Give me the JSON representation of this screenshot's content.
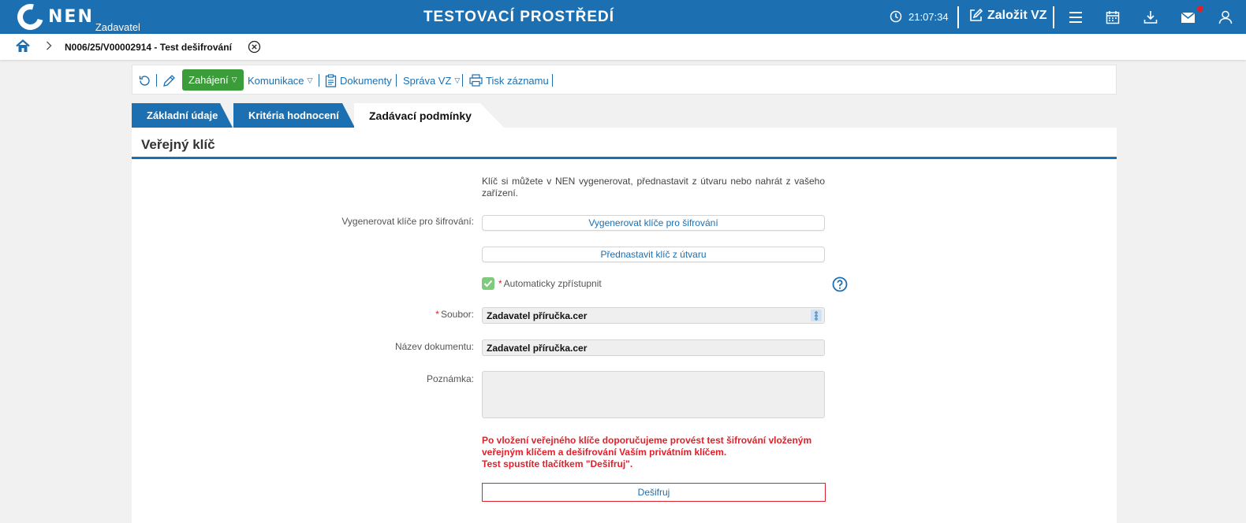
{
  "header": {
    "logo_text": "NEN",
    "logo_sub": "Zadavatel",
    "environment": "TESTOVACÍ PROSTŘEDÍ",
    "clock": "21:07:34",
    "create_label": "Založit VZ"
  },
  "breadcrumb": {
    "title": "N006/25/V00002914 - Test dešifrování"
  },
  "actions": {
    "start": "Zahájení",
    "communication": "Komunikace",
    "documents": "Dokumenty",
    "manage": "Správa VZ",
    "print": "Tisk záznamu"
  },
  "tabs": [
    {
      "label": "Základní údaje"
    },
    {
      "label": "Kritéria hodnocení"
    },
    {
      "label": "Zadávací podmínky"
    }
  ],
  "section": {
    "title": "Veřejný klíč",
    "info": "Klíč si můžete v NEN vygenerovat, přednastavit z útvaru nebo nahrát z vašeho zařízení."
  },
  "form": {
    "generate_label": "Vygenerovat klíče pro šifrování:",
    "generate_button": "Vygenerovat klíče pro šifrování",
    "preset_button": "Přednastavit klíč z útvaru",
    "auto_label": "Automaticky zpřístupnit",
    "auto_checked": true,
    "file_label": "Soubor:",
    "file_value": "Zadavatel příručka.cer",
    "docname_label": "Název dokumentu:",
    "docname_value": "Zadavatel příručka.cer",
    "note_label": "Poznámka:",
    "note_value": "",
    "warning_line1": "Po vložení veřejného klíče doporučujeme provést test šifrování vloženým",
    "warning_line2": "veřejným klíčem a dešifrování Vaším privátním klíčem.",
    "warning_line3": "Test spustíte tlačítkem \"Dešifruj\".",
    "decrypt_button": "Dešifruj",
    "required_mark": "*"
  },
  "colors": {
    "brand_blue": "#1c6fb0",
    "green": "#3a9d3a",
    "error_red": "#e0202a"
  }
}
